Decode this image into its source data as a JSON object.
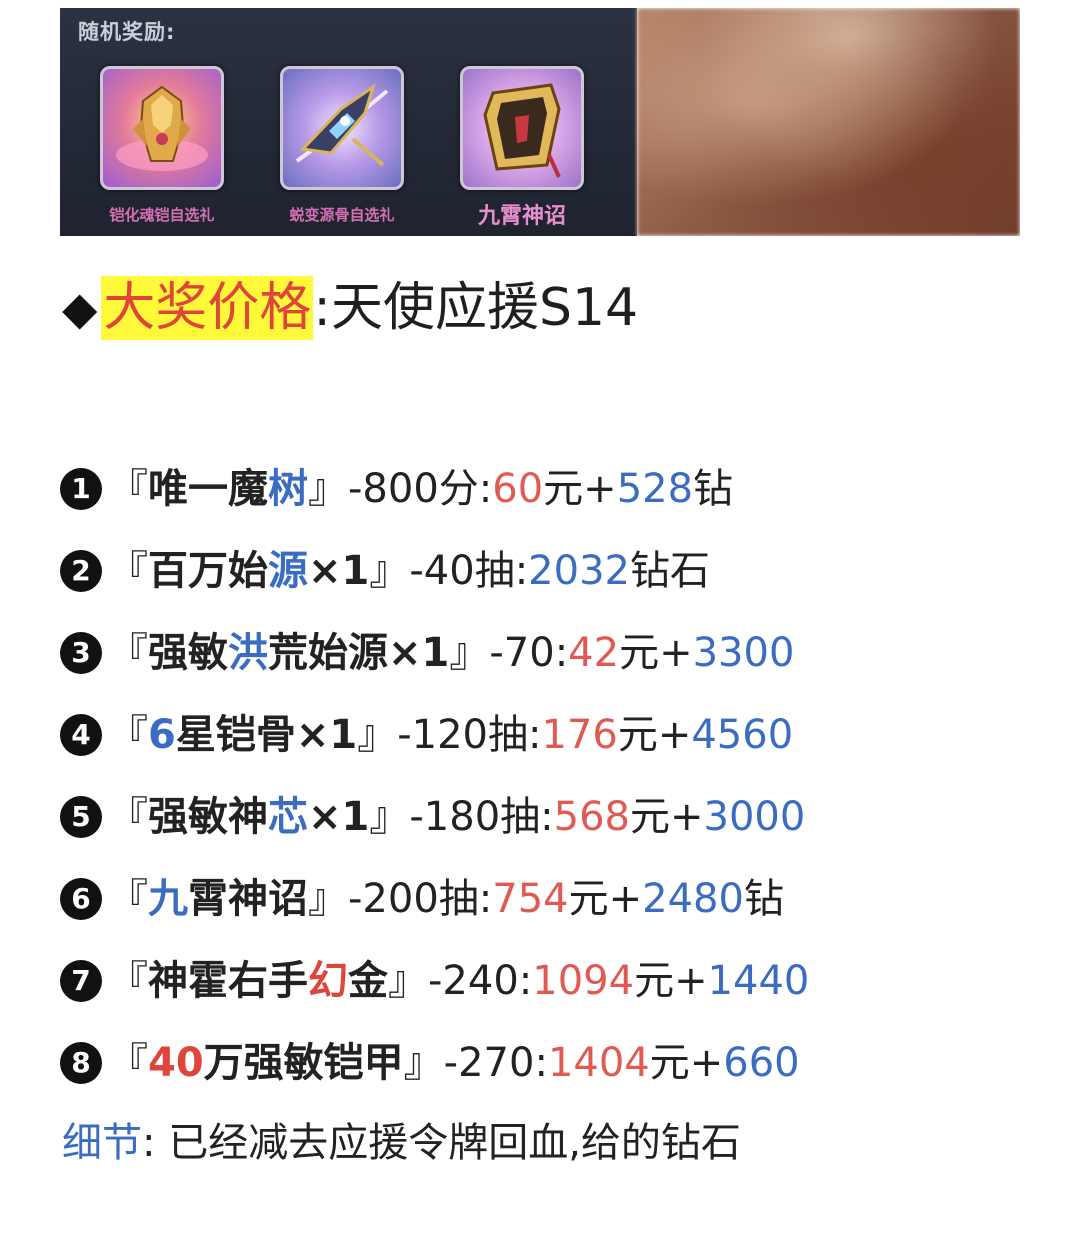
{
  "banner": {
    "title": "随机奖励:",
    "rewards": [
      {
        "caption": "铠化魂铠自选礼"
      },
      {
        "caption": "蜕变源骨自选礼"
      },
      {
        "caption": "九霄神诏"
      }
    ]
  },
  "heading": {
    "marker": "◆",
    "highlight": "大奖价格",
    "colon": ":",
    "rest": "天使应援S14"
  },
  "items": [
    {
      "num": "1",
      "open": "『",
      "close": "』",
      "name_a": "唯一魔",
      "name_b": "树",
      "name_c": "",
      "cost": "-800分:",
      "price": "60",
      "yuan": "元",
      "plus": "+",
      "diamonds": "528",
      "unit": "钻"
    },
    {
      "num": "2",
      "open": "『",
      "close": "』",
      "name_a": "百万始",
      "name_b": "源",
      "name_c": "×1",
      "cost": "-40抽:",
      "price": "",
      "yuan": "",
      "plus": "",
      "diamonds": "2032",
      "unit": "钻石"
    },
    {
      "num": "3",
      "open": "『",
      "close": "』",
      "name_a": "强敏",
      "name_b": "洪",
      "name_c": "荒始源×1",
      "cost": "-70:",
      "price": "42",
      "yuan": "元",
      "plus": "+",
      "diamonds": "3300",
      "unit": ""
    },
    {
      "num": "4",
      "open": "『",
      "close": "』",
      "name_a": "",
      "name_b": "6",
      "name_c": "星铠骨×1",
      "cost": "-120抽:",
      "price": "176",
      "yuan": "元",
      "plus": "+",
      "diamonds": "4560",
      "unit": ""
    },
    {
      "num": "5",
      "open": "『",
      "close": "』",
      "name_a": "强敏神",
      "name_b": "芯",
      "name_c": "×1",
      "cost": "-180抽:",
      "price": "568",
      "yuan": "元",
      "plus": "+",
      "diamonds": "3000",
      "unit": ""
    },
    {
      "num": "6",
      "open": "『",
      "close": "』",
      "name_a": "",
      "name_b": "九",
      "name_c": "霄神诏",
      "cost": "-200抽:",
      "price": "754",
      "yuan": "元",
      "plus": "+",
      "diamonds": "2480",
      "unit": "钻"
    },
    {
      "num": "7",
      "open": "『",
      "close": "』",
      "name_a": "神霍右手",
      "name_r": "幻",
      "name_c": "金",
      "cost": "-240:",
      "price": "1094",
      "yuan": "元",
      "plus": "+",
      "diamonds": "1440",
      "unit": ""
    },
    {
      "num": "8",
      "open": "『",
      "close": "』",
      "name_a": "",
      "name_r": "40",
      "name_c": "万强敏铠甲",
      "cost": "-270:",
      "price": "1404",
      "yuan": "元",
      "plus": "+",
      "diamonds": "660",
      "unit": ""
    }
  ],
  "note": {
    "label": "细节",
    "colon": ":",
    "text": "已经减去应援令牌回血,给的钻石"
  },
  "colors": {
    "highlight_bg": "#fff93a",
    "red": "#e05a52",
    "blue": "#3a6cc1"
  },
  "icons": [
    "armor-gift-icon",
    "bone-gift-icon",
    "divine-edict-icon"
  ]
}
